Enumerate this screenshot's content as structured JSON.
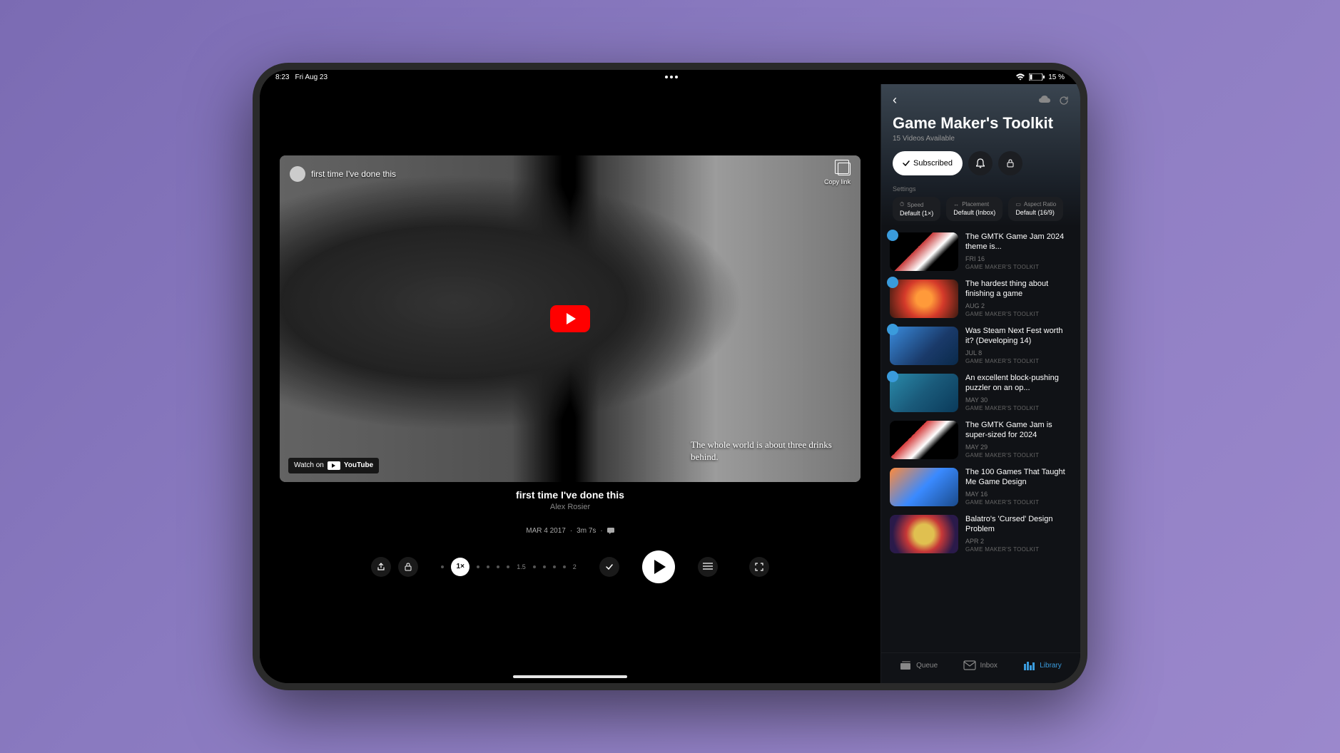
{
  "status": {
    "time": "8:23",
    "date": "Fri Aug 23",
    "battery": "15 %"
  },
  "video": {
    "overlay_title": "first time I've done this",
    "copy_link": "Copy link",
    "watch_on": "Watch on",
    "caption": "The whole world is about three drinks behind.",
    "title": "first time I've done this",
    "author": "Alex Rosier",
    "date": "MAR 4 2017",
    "duration": "3m 7s",
    "speed_current": "1×",
    "speed_mid": "1.5",
    "speed_max": "2"
  },
  "sidebar": {
    "channel_title": "Game Maker's Toolkit",
    "channel_sub": "15 Videos Available",
    "subscribe_label": "Subscribed",
    "settings_label": "Settings",
    "chips": [
      {
        "top": "Speed",
        "bot": "Default (1×)"
      },
      {
        "top": "Placement",
        "bot": "Default (Inbox)"
      },
      {
        "top": "Aspect Ratio",
        "bot": "Default (16/9)"
      }
    ],
    "videos": [
      {
        "title": "The GMTK Game Jam 2024 theme is...",
        "date": "FRI 16",
        "channel": "GAME MAKER'S TOOLKIT",
        "thumb": "thumb-1",
        "badge": true
      },
      {
        "title": "The hardest thing about finishing a game",
        "date": "AUG 2",
        "channel": "GAME MAKER'S TOOLKIT",
        "thumb": "thumb-2",
        "badge": true
      },
      {
        "title": "Was Steam Next Fest worth it? (Developing 14)",
        "date": "JUL 8",
        "channel": "GAME MAKER'S TOOLKIT",
        "thumb": "thumb-3",
        "badge": true
      },
      {
        "title": "An excellent block-pushing puzzler on an op...",
        "date": "MAY 30",
        "channel": "GAME MAKER'S TOOLKIT",
        "thumb": "thumb-4",
        "badge": true
      },
      {
        "title": "The GMTK Game Jam is super-sized for 2024",
        "date": "MAY 29",
        "channel": "GAME MAKER'S TOOLKIT",
        "thumb": "thumb-5",
        "badge": false
      },
      {
        "title": "The 100 Games That Taught Me Game Design",
        "date": "MAY 16",
        "channel": "GAME MAKER'S TOOLKIT",
        "thumb": "thumb-6",
        "badge": false
      },
      {
        "title": "Balatro's 'Cursed' Design Problem",
        "date": "APR 2",
        "channel": "GAME MAKER'S TOOLKIT",
        "thumb": "thumb-7",
        "badge": false
      }
    ],
    "tabs": {
      "queue": "Queue",
      "inbox": "Inbox",
      "library": "Library"
    }
  }
}
